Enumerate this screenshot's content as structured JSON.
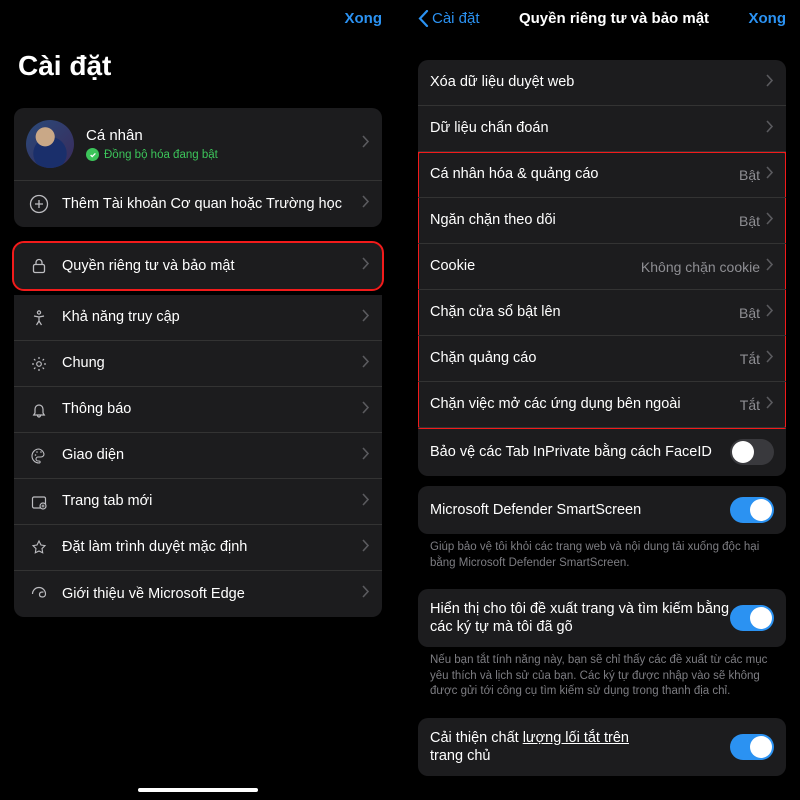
{
  "left": {
    "done": "Xong",
    "header": "Cài đặt",
    "account": {
      "name": "Cá nhân",
      "sync": "Đồng bộ hóa đang bật"
    },
    "addAccount": "Thêm Tài khoản Cơ quan hoặc Trường học",
    "items": [
      {
        "label": "Quyền riêng tư và bảo mật",
        "icon": "lock"
      },
      {
        "label": "Khả năng truy cập",
        "icon": "accessibility"
      },
      {
        "label": "Chung",
        "icon": "gear"
      },
      {
        "label": "Thông báo",
        "icon": "bell"
      },
      {
        "label": "Giao diện",
        "icon": "palette"
      },
      {
        "label": "Trang tab mới",
        "icon": "tab"
      },
      {
        "label": "Đặt làm trình duyệt mặc định",
        "icon": "star"
      },
      {
        "label": "Giới thiệu về Microsoft Edge",
        "icon": "edge"
      }
    ]
  },
  "right": {
    "back": "Cài đặt",
    "title": "Quyền riêng tư và bảo mật",
    "done": "Xong",
    "topItems": [
      {
        "label": "Xóa dữ liệu duyệt web"
      },
      {
        "label": "Dữ liệu chẩn đoán"
      }
    ],
    "privacyItems": [
      {
        "label": "Cá nhân hóa & quảng cáo",
        "value": "Bật"
      },
      {
        "label": "Ngăn chặn theo dõi",
        "value": "Bật"
      },
      {
        "label": "Cookie",
        "value": "Không chặn cookie"
      },
      {
        "label": "Chặn cửa sổ bật lên",
        "value": "Bật"
      },
      {
        "label": "Chặn quảng cáo",
        "value": "Tắt"
      },
      {
        "label": "Chặn việc mở các ứng dụng bên ngoài",
        "value": "Tắt"
      }
    ],
    "faceId": "Bảo vệ các Tab InPrivate bằng cách FaceID",
    "smartscreen": "Microsoft Defender SmartScreen",
    "smartscreenDesc": "Giúp bảo vệ tôi khỏi các trang web và nội dung tải xuống độc hại bằng Microsoft Defender SmartScreen.",
    "suggest": "Hiển thị cho tôi đề xuất trang và tìm kiếm bằng các ký tự mà tôi đã gõ",
    "suggestDesc": "Nếu bạn tắt tính năng này, bạn sẽ chỉ thấy các đề xuất từ các mục yêu thích và lịch sử của bạn. Các ký tự được nhập vào sẽ không được gửi tới công cụ tìm kiếm sử dụng trong thanh địa chỉ.",
    "improve1": "Cải thiện chất ",
    "improve2": "lượng lối tắt trên",
    "improve3": "trang chủ"
  }
}
